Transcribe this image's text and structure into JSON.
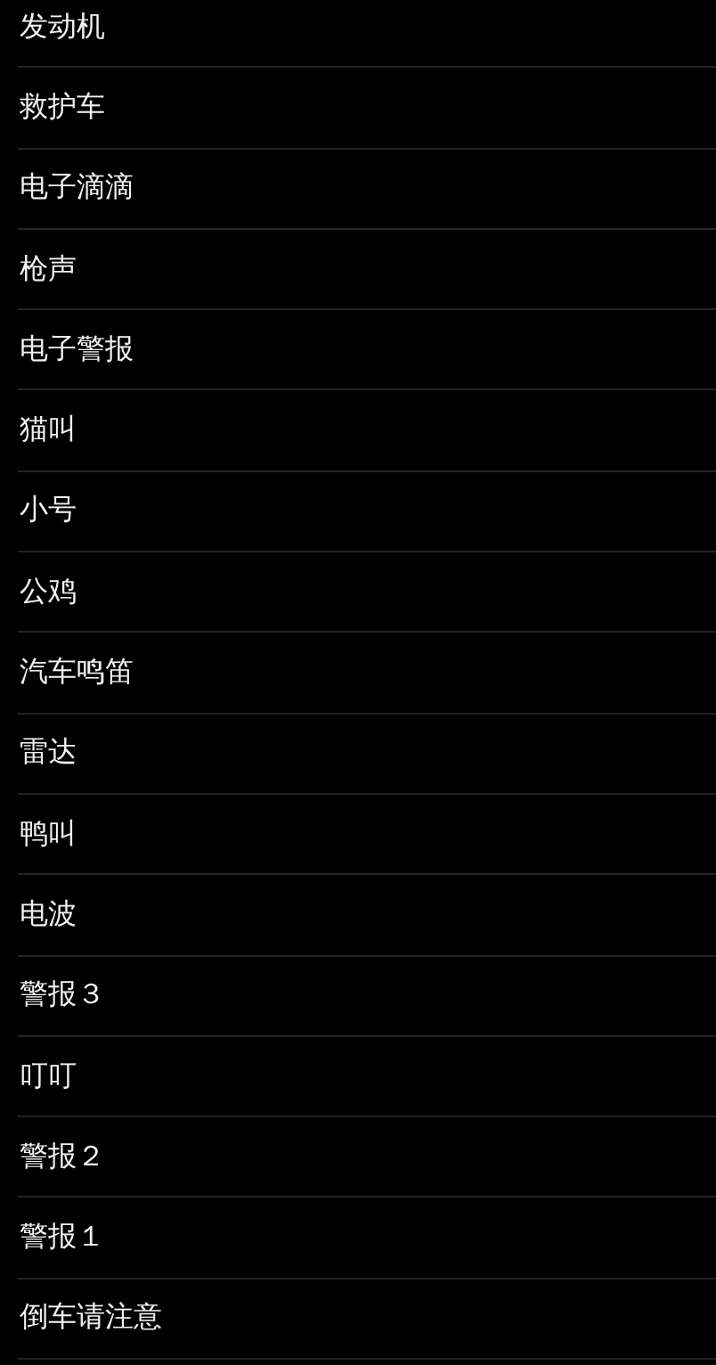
{
  "sounds": [
    {
      "label": "发动机"
    },
    {
      "label": "救护车"
    },
    {
      "label": "电子滴滴"
    },
    {
      "label": "枪声"
    },
    {
      "label": "电子警报"
    },
    {
      "label": "猫叫"
    },
    {
      "label": "小号"
    },
    {
      "label": "公鸡"
    },
    {
      "label": "汽车鸣笛"
    },
    {
      "label": "雷达"
    },
    {
      "label": "鸭叫"
    },
    {
      "label": "电波"
    },
    {
      "label": "警报３"
    },
    {
      "label": "叮叮"
    },
    {
      "label": "警报２"
    },
    {
      "label": "警报１"
    },
    {
      "label": "倒车请注意"
    }
  ]
}
